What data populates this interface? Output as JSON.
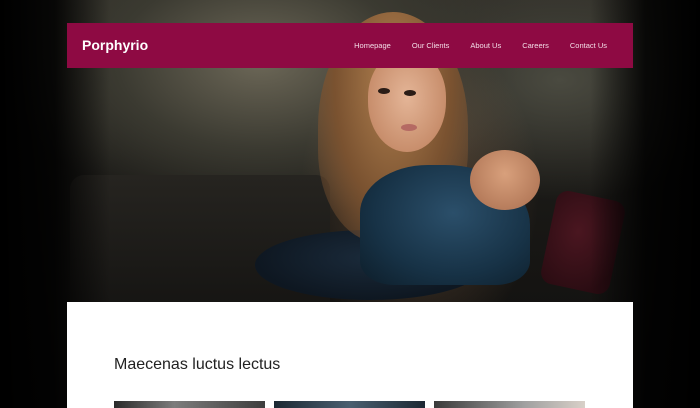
{
  "site": {
    "brand": "Porphyrio",
    "accent_color": "#8e0a43"
  },
  "nav": {
    "items": [
      {
        "label": "Homepage"
      },
      {
        "label": "Our Clients"
      },
      {
        "label": "About Us"
      },
      {
        "label": "Careers"
      },
      {
        "label": "Contact Us"
      }
    ]
  },
  "hero": {
    "image": "portrait-photo"
  },
  "content": {
    "section_title": "Maecenas luctus lectus",
    "thumbnails": [
      "thumbnail-image",
      "thumbnail-image",
      "thumbnail-image"
    ]
  }
}
